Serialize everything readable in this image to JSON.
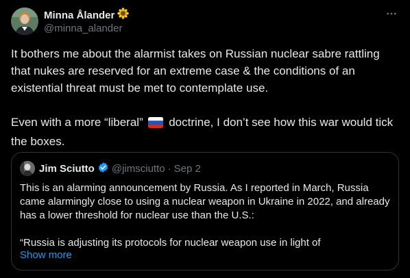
{
  "author": {
    "display_name": "Minna Ålander",
    "handle": "@minna_alander",
    "badge_icon": "sunflower-icon"
  },
  "more_icon": "more-horizontal-icon",
  "tweet": {
    "paragraph_1": "It bothers me about the alarmist takes on Russian nuclear sabre rattling that nukes are reserved for an extreme case & the conditions of an existential threat must be met to contemplate use.",
    "paragraph_2_before_flag": "Even with a more “liberal”",
    "flag_icon": "russia-flag-icon",
    "paragraph_2_after_flag": "doctrine, I don’t see how this war would tick the boxes."
  },
  "quoted_tweet": {
    "display_name": "Jim Sciutto",
    "verified_icon": "verified-badge-icon",
    "handle": "@jimsciutto",
    "separator": "·",
    "date": "Sep 2",
    "paragraph_1": "This is an alarming announcement by Russia. As I reported in March, Russia came alarmingly close to using a nuclear weapon in Ukraine in 2022, and already has a lower threshold for nuclear use than the U.S.:",
    "paragraph_2": "“Russia is adjusting its protocols for nuclear weapon use in light of",
    "show_more": "Show more"
  },
  "colors": {
    "background": "#000000",
    "text_primary": "#e7e9ea",
    "text_secondary": "#71767b",
    "link": "#1d9bf0",
    "border": "#2f3336",
    "verified": "#1d9bf0"
  }
}
